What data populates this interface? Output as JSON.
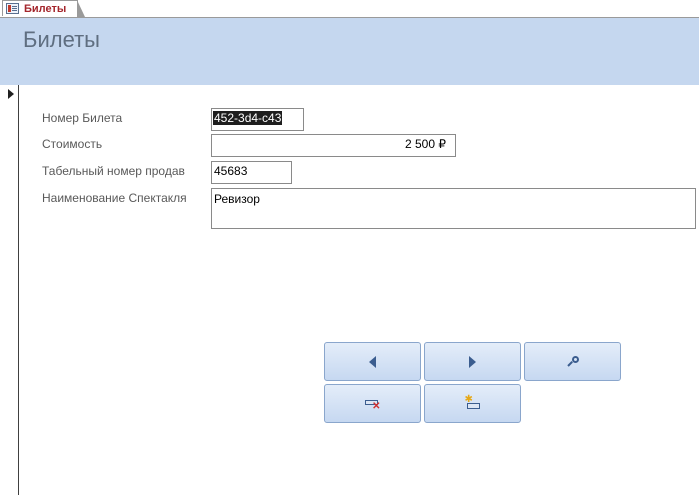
{
  "tab": {
    "label": "Билеты",
    "icon": "form-icon"
  },
  "header": {
    "title": "Билеты"
  },
  "fields": {
    "ticket_number": {
      "label": "Номер Билета",
      "value": "452-3d4-c43"
    },
    "price": {
      "label": "Стоимость",
      "value": "2 500 ₽"
    },
    "seller_id": {
      "label": "Табельный номер продав",
      "value": "45683"
    },
    "performance": {
      "label": "Наименование Спектакля",
      "value": "Ревизор"
    }
  },
  "nav_buttons": [
    {
      "name": "previous-record-button",
      "icon": "triangle-left-icon"
    },
    {
      "name": "next-record-button",
      "icon": "triangle-right-icon"
    },
    {
      "name": "find-record-button",
      "icon": "magnifier-icon"
    },
    {
      "name": "delete-record-button",
      "icon": "delete-record-icon"
    },
    {
      "name": "new-record-button",
      "icon": "new-record-icon"
    }
  ],
  "colors": {
    "header_band": "#c5d7ef",
    "tab_label": "#a4262c",
    "button_icon": "#3b5d8f"
  }
}
